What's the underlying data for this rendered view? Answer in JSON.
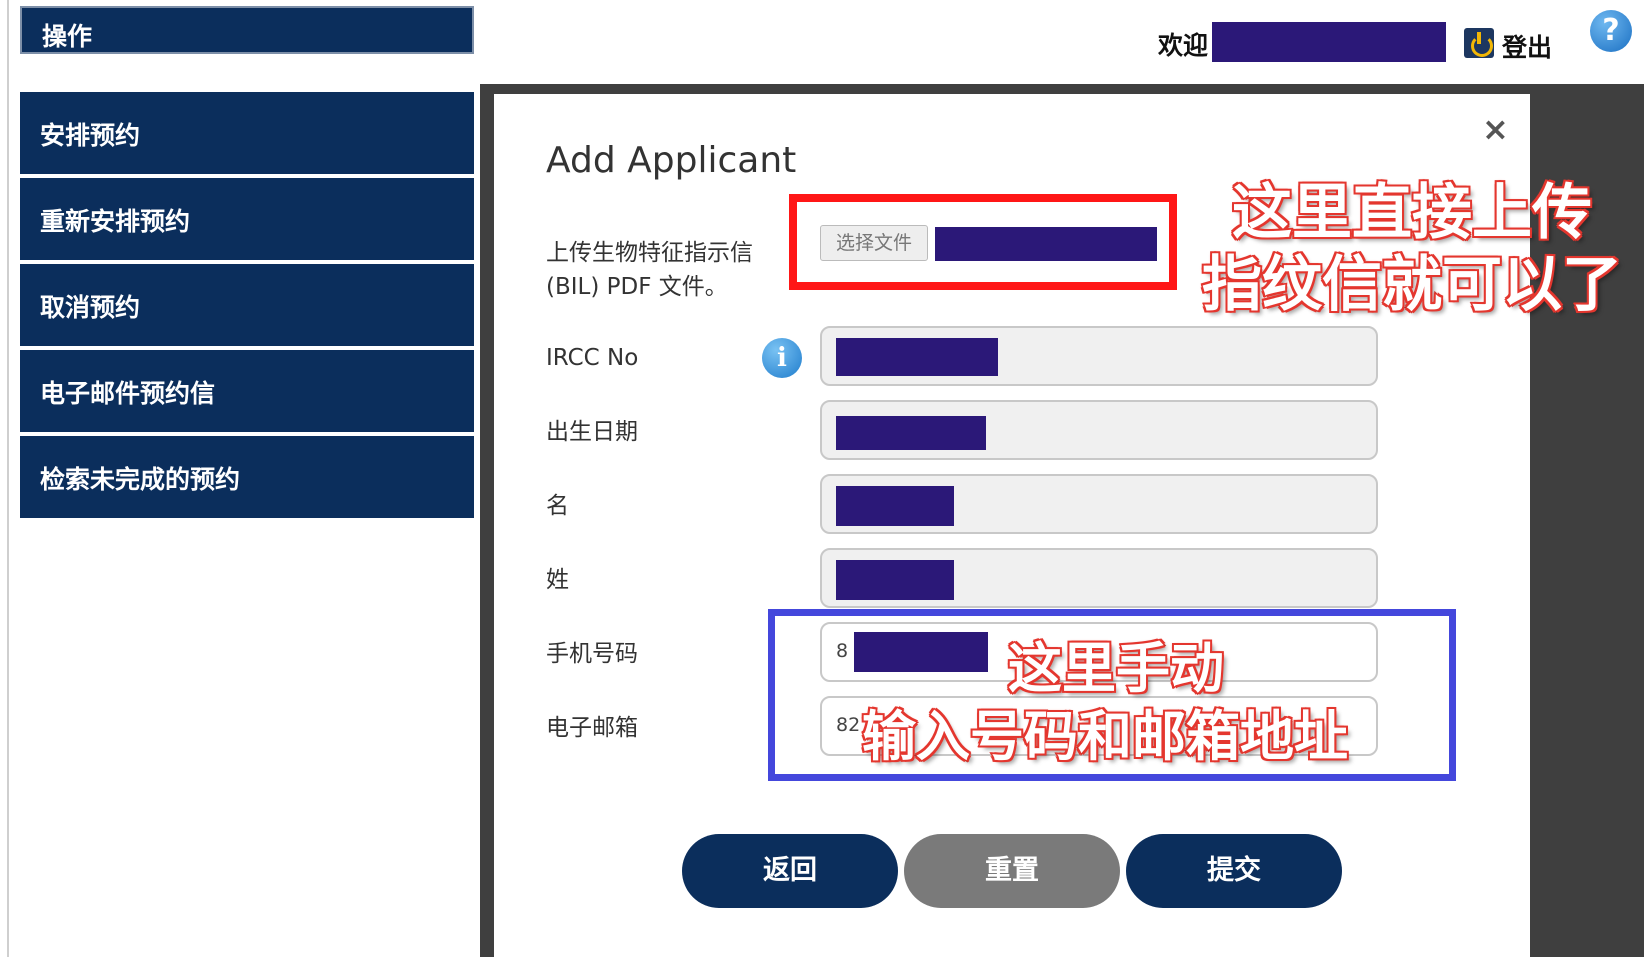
{
  "sidebar": {
    "header": "操作",
    "items": [
      {
        "label": "安排预约"
      },
      {
        "label": "重新安排预约"
      },
      {
        "label": "取消预约"
      },
      {
        "label": "电子邮件预约信"
      },
      {
        "label": "检索未完成的预约"
      }
    ]
  },
  "topbar": {
    "welcome": "欢迎",
    "logout": "登出",
    "help": "?",
    "logout_icon": "power-icon",
    "help_icon": "question-icon"
  },
  "modal": {
    "title": "Add Applicant",
    "close": "×",
    "bil_label_line1": "上传生物特征指示信",
    "bil_label_line2": "(BIL) PDF 文件。",
    "file_button": "选择文件",
    "ircc_label": "IRCC No",
    "info_icon": "i",
    "dob_label": "出生日期",
    "first_name_label": "名",
    "last_name_label": "姓",
    "phone_label": "手机号码",
    "phone_prefix": "8",
    "email_label": "电子邮箱",
    "email_prefix": "82",
    "buttons": {
      "back": "返回",
      "reset": "重置",
      "submit": "提交"
    }
  },
  "annotations": {
    "upload_line1": "这里直接上传",
    "upload_line2": "指纹信就可以了",
    "manual_line1": "这里手动",
    "manual_line2": "输入号码和邮箱地址"
  },
  "colors": {
    "navy": "#0b2e5c",
    "redact": "#2b1878",
    "annotation_red": "#ff1717",
    "annotation_blue": "#4447dc"
  }
}
